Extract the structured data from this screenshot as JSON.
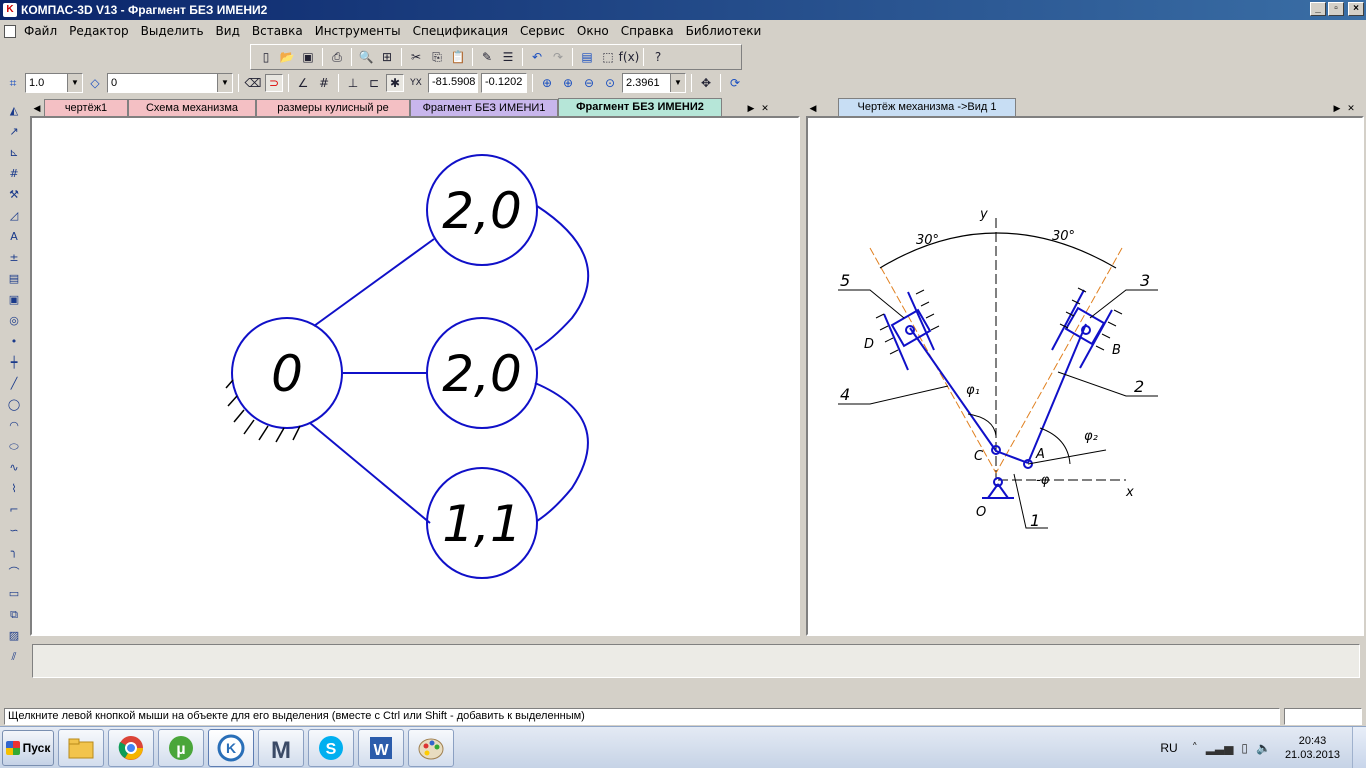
{
  "window": {
    "title": "КОМПАС-3D V13 - Фрагмент БЕЗ ИМЕНИ2",
    "app_icon_letter": "K",
    "minimize": "_",
    "restore": "▫",
    "close": "×"
  },
  "menu": {
    "items": [
      {
        "label": "Файл"
      },
      {
        "label": "Редактор"
      },
      {
        "label": "Выделить"
      },
      {
        "label": "Вид"
      },
      {
        "label": "Вставка"
      },
      {
        "label": "Инструменты"
      },
      {
        "label": "Спецификация"
      },
      {
        "label": "Сервис"
      },
      {
        "label": "Окно"
      },
      {
        "label": "Справка"
      },
      {
        "label": "Библиотеки"
      }
    ]
  },
  "toolbar2": {
    "step_value": "1.0",
    "layer_value": "0",
    "coord_x": "-81.5908",
    "coord_y": "-0.1202",
    "zoom_value": "2.3961"
  },
  "left_panel": {
    "tabs": [
      {
        "label": "чертёж1",
        "color": "#f4c0c4"
      },
      {
        "label": "Схема механизма",
        "color": "#f4c0c4"
      },
      {
        "label": "размеры кулисный ре",
        "color": "#f4c0c4"
      },
      {
        "label": "Фрагмент БЕЗ ИМЕНИ1",
        "color": "#c8b6ec"
      },
      {
        "label": "Фрагмент БЕЗ ИМЕНИ2",
        "color": "#b6e6d8"
      }
    ],
    "graph": {
      "nodes": [
        {
          "id": "root",
          "label": "0"
        },
        {
          "id": "top",
          "label": "2,0"
        },
        {
          "id": "mid",
          "label": "2,0"
        },
        {
          "id": "bottom",
          "label": "1,1"
        }
      ]
    }
  },
  "right_panel": {
    "tab": {
      "label": "Чертёж механизма ->Вид 1",
      "color": "#c8def4"
    },
    "drawing": {
      "axis_y": "y",
      "axis_x": "x",
      "angle_left": "30°",
      "angle_right": "30°",
      "labels": {
        "n5": "5",
        "n3": "3",
        "n4": "4",
        "n2": "2",
        "n1": "1",
        "D": "D",
        "B": "B",
        "C": "C",
        "A": "A",
        "O": "O",
        "phi1": "φ₁",
        "phi2": "φ₂",
        "phi": "-φ"
      }
    }
  },
  "status": {
    "message": "Щелкните левой кнопкой мыши на объекте для его выделения (вместе с Ctrl или Shift - добавить к выделенным)"
  },
  "taskbar": {
    "start_label": "Пуск",
    "apps": [
      {
        "name": "explorer",
        "icon": "folder-icon"
      },
      {
        "name": "chrome",
        "icon": "chrome-icon"
      },
      {
        "name": "utorrent",
        "icon": "utorrent-icon"
      },
      {
        "name": "kompas",
        "icon": "kompas-icon"
      },
      {
        "name": "mathcad",
        "icon": "mathcad-icon"
      },
      {
        "name": "skype",
        "icon": "skype-icon"
      },
      {
        "name": "word",
        "icon": "word-icon"
      },
      {
        "name": "paint",
        "icon": "paint-icon"
      }
    ],
    "lang": "RU",
    "time": "20:43",
    "date": "21.03.2013"
  },
  "colors": {
    "drawing_blue": "#1010c8",
    "center_orange": "#e08020"
  }
}
